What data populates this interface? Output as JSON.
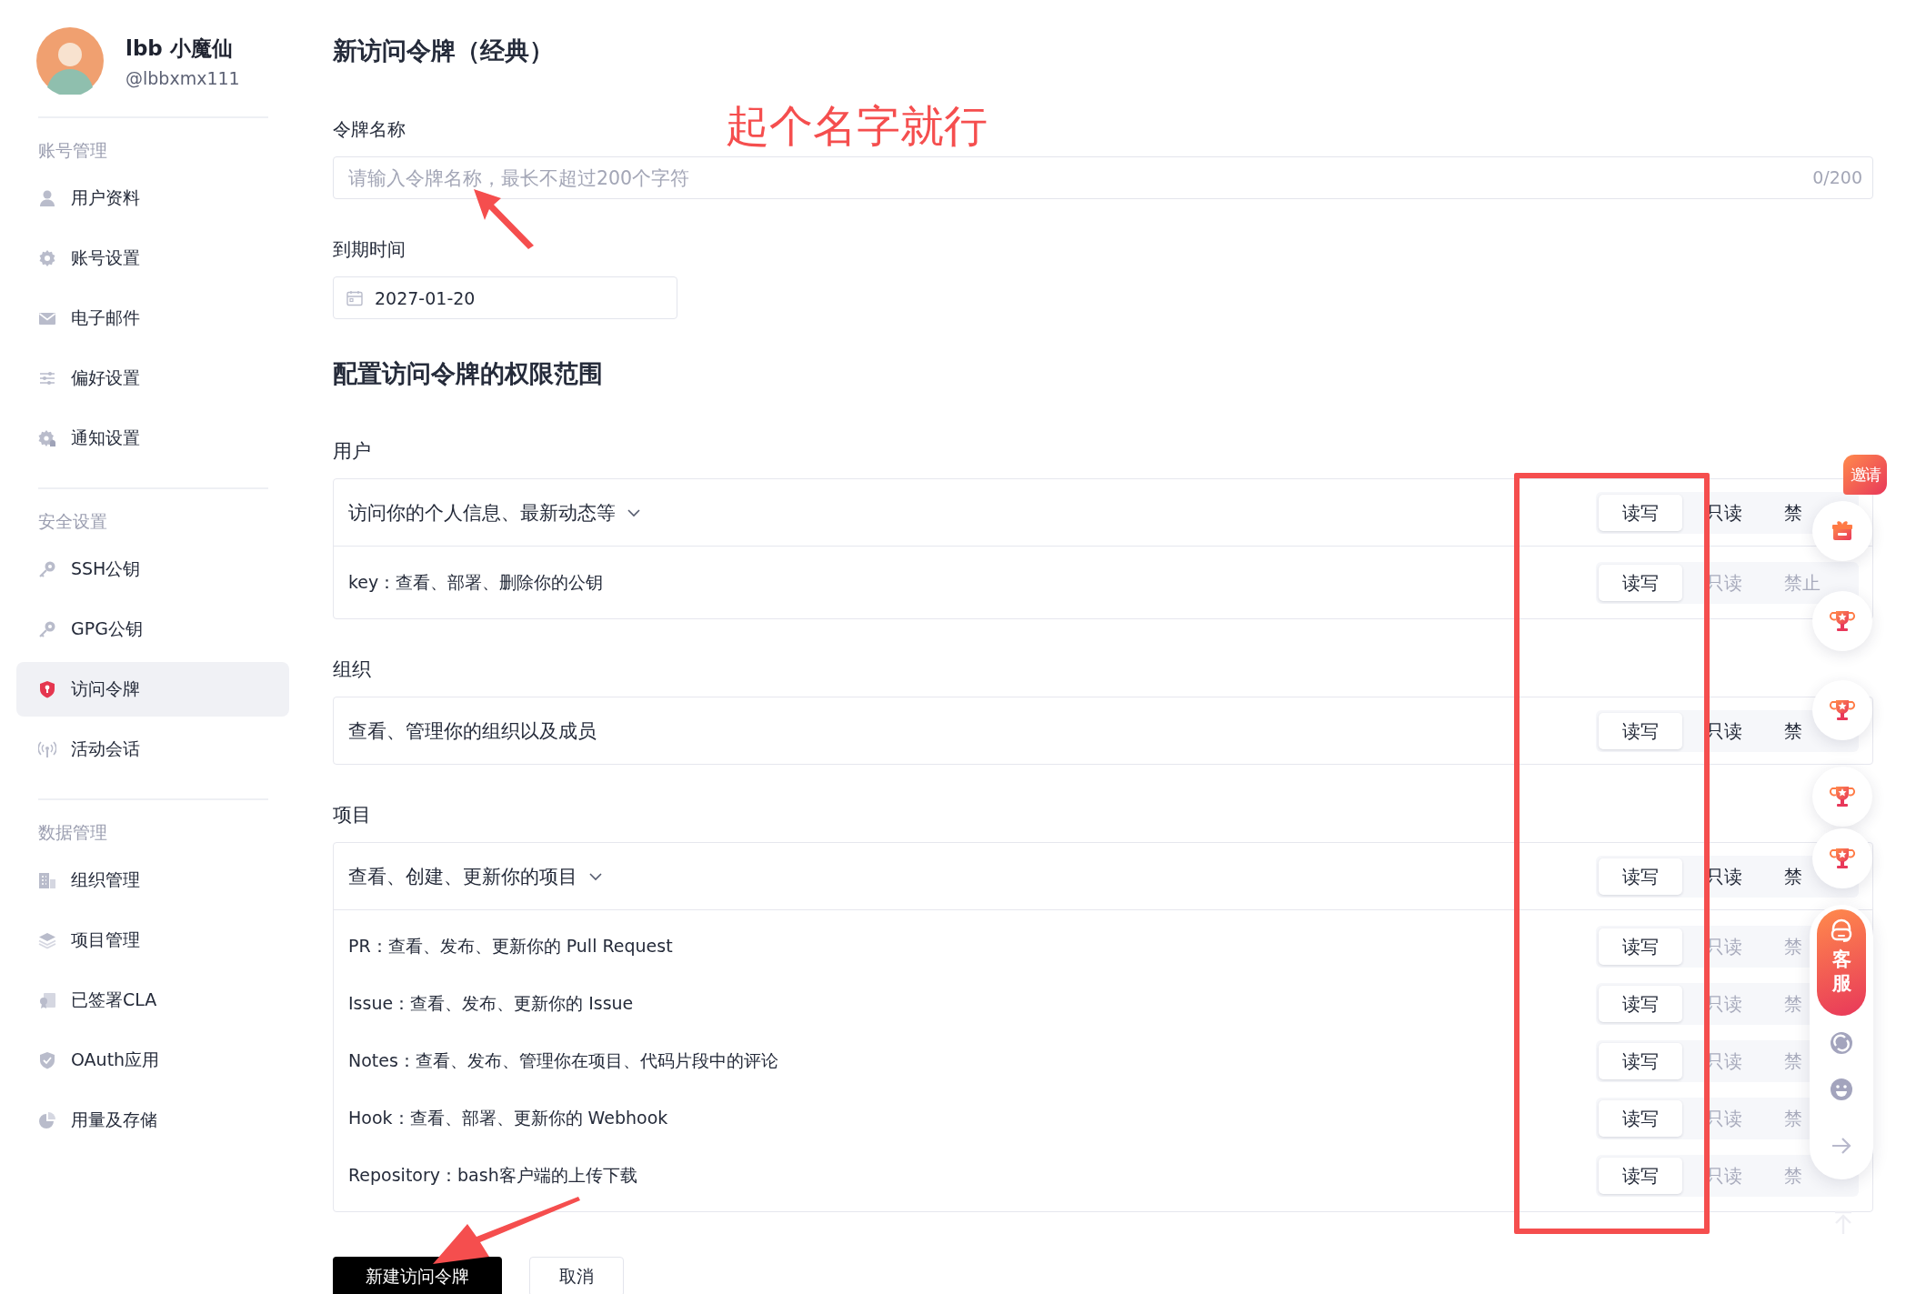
{
  "sidebar": {
    "profile": {
      "name": "lbb 小魔仙",
      "handle": "@lbbxmx111"
    },
    "sections": [
      {
        "title": "账号管理",
        "items": [
          {
            "label": "用户资料",
            "selected": false
          },
          {
            "label": "账号设置",
            "selected": false
          },
          {
            "label": "电子邮件",
            "selected": false
          },
          {
            "label": "偏好设置",
            "selected": false
          },
          {
            "label": "通知设置",
            "selected": false
          }
        ]
      },
      {
        "title": "安全设置",
        "items": [
          {
            "label": "SSH公钥",
            "selected": false
          },
          {
            "label": "GPG公钥",
            "selected": false
          },
          {
            "label": "访问令牌",
            "selected": true
          },
          {
            "label": "活动会话",
            "selected": false
          }
        ]
      },
      {
        "title": "数据管理",
        "items": [
          {
            "label": "组织管理",
            "selected": false
          },
          {
            "label": "项目管理",
            "selected": false
          },
          {
            "label": "已签署CLA",
            "selected": false
          },
          {
            "label": "OAuth应用",
            "selected": false
          },
          {
            "label": "用量及存储",
            "selected": false
          }
        ]
      }
    ]
  },
  "page": {
    "title": "新访问令牌（经典）",
    "name_field": {
      "label": "令牌名称",
      "placeholder": "请输入令牌名称，最长不超过200个字符",
      "counter": "0/200"
    },
    "expiry_field": {
      "label": "到期时间",
      "value": "2027-01-20"
    },
    "scope_title": "配置访问令牌的权限范围",
    "groups": [
      {
        "title": "用户",
        "rows": [
          {
            "kind": "header",
            "text": "访问你的个人信息、最新动态等",
            "collapsible": true,
            "options": [
              {
                "label": "读写",
                "selected": true,
                "disabled": false
              },
              {
                "label": "只读",
                "selected": false,
                "disabled": false
              },
              {
                "label": "禁",
                "selected": false,
                "disabled": false
              }
            ]
          },
          {
            "kind": "sub",
            "text": "key：查看、部署、删除你的公钥",
            "collapsible": false,
            "options": [
              {
                "label": "读写",
                "selected": true,
                "disabled": false
              },
              {
                "label": "只读",
                "selected": false,
                "disabled": true
              },
              {
                "label": "禁止",
                "selected": false,
                "disabled": true
              }
            ]
          }
        ]
      },
      {
        "title": "组织",
        "rows": [
          {
            "kind": "header",
            "text": "查看、管理你的组织以及成员",
            "collapsible": false,
            "options": [
              {
                "label": "读写",
                "selected": true,
                "disabled": false
              },
              {
                "label": "只读",
                "selected": false,
                "disabled": false
              },
              {
                "label": "禁",
                "selected": false,
                "disabled": false
              }
            ]
          }
        ]
      },
      {
        "title": "项目",
        "rows": [
          {
            "kind": "header",
            "text": "查看、创建、更新你的项目",
            "collapsible": true,
            "options": [
              {
                "label": "读写",
                "selected": true,
                "disabled": false
              },
              {
                "label": "只读",
                "selected": false,
                "disabled": false
              },
              {
                "label": "禁",
                "selected": false,
                "disabled": false
              }
            ]
          },
          {
            "kind": "sub",
            "text": "PR：查看、发布、更新你的 Pull Request",
            "collapsible": false,
            "options": [
              {
                "label": "读写",
                "selected": true,
                "disabled": false
              },
              {
                "label": "只读",
                "selected": false,
                "disabled": true
              },
              {
                "label": "禁",
                "selected": false,
                "disabled": true
              }
            ]
          },
          {
            "kind": "sub",
            "text": "Issue：查看、发布、更新你的 Issue",
            "collapsible": false,
            "options": [
              {
                "label": "读写",
                "selected": true,
                "disabled": false
              },
              {
                "label": "只读",
                "selected": false,
                "disabled": true
              },
              {
                "label": "禁",
                "selected": false,
                "disabled": true
              }
            ]
          },
          {
            "kind": "sub",
            "text": "Notes：查看、发布、管理你在项目、代码片段中的评论",
            "collapsible": false,
            "options": [
              {
                "label": "读写",
                "selected": true,
                "disabled": false
              },
              {
                "label": "只读",
                "selected": false,
                "disabled": true
              },
              {
                "label": "禁",
                "selected": false,
                "disabled": true
              }
            ]
          },
          {
            "kind": "sub",
            "text": "Hook：查看、部署、更新你的 Webhook",
            "collapsible": false,
            "options": [
              {
                "label": "读写",
                "selected": true,
                "disabled": false
              },
              {
                "label": "只读",
                "selected": false,
                "disabled": true
              },
              {
                "label": "禁",
                "selected": false,
                "disabled": true
              }
            ]
          },
          {
            "kind": "sub",
            "text": "Repository：bash客户端的上传下载",
            "collapsible": false,
            "options": [
              {
                "label": "读写",
                "selected": true,
                "disabled": false
              },
              {
                "label": "只读",
                "selected": false,
                "disabled": true
              },
              {
                "label": "禁",
                "selected": false,
                "disabled": true
              }
            ]
          }
        ]
      }
    ],
    "buttons": [
      {
        "label": "新建访问令牌",
        "kind": "primary"
      },
      {
        "label": "取消",
        "kind": "secondary"
      }
    ]
  },
  "floating_toolbar": {
    "invite": "邀请",
    "support": "客服"
  },
  "annotation": {
    "note": "起个名字就行"
  }
}
